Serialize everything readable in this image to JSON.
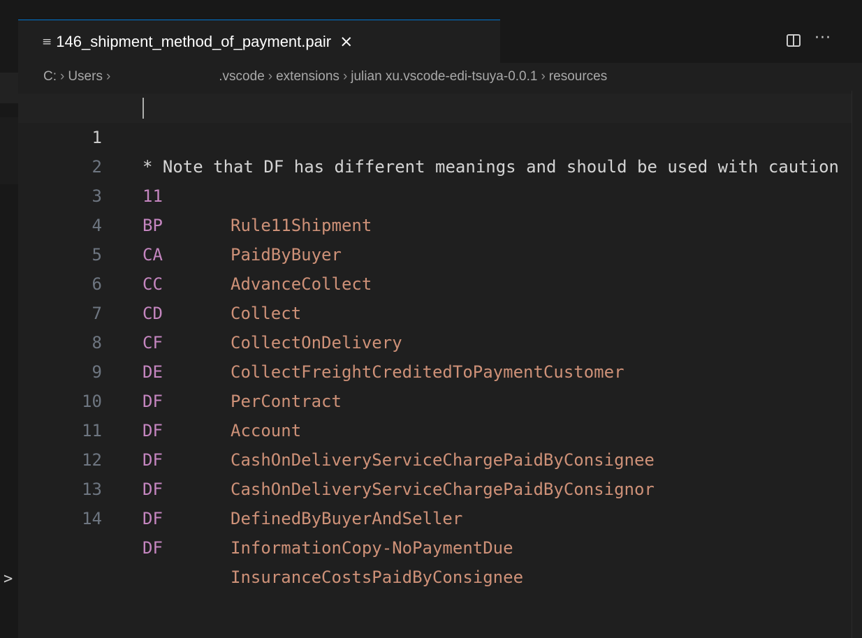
{
  "tab": {
    "label": "146_shipment_method_of_payment.pair",
    "file_icon": "≡",
    "close_icon": "×"
  },
  "toolbar": {
    "more_icon": "···"
  },
  "breadcrumb": [
    "C:",
    "Users",
    ".vscode",
    "extensions",
    "julian xu.vscode-edi-tsuya-0.0.1",
    "resources"
  ],
  "editor": {
    "lines": [
      {
        "num": "1",
        "comment": "* Note that DF has different meanings and should be used with caution"
      },
      {
        "num": "2",
        "key": "11",
        "value": "Rule11Shipment"
      },
      {
        "num": "3",
        "key": "BP",
        "value": "PaidByBuyer"
      },
      {
        "num": "4",
        "key": "CA",
        "value": "AdvanceCollect"
      },
      {
        "num": "5",
        "key": "CC",
        "value": "Collect"
      },
      {
        "num": "6",
        "key": "CD",
        "value": "CollectOnDelivery"
      },
      {
        "num": "7",
        "key": "CF",
        "value": "CollectFreightCreditedToPaymentCustomer"
      },
      {
        "num": "8",
        "key": "DE",
        "value": "PerContract"
      },
      {
        "num": "9",
        "key": "DF",
        "value": "Account"
      },
      {
        "num": "10",
        "key": "DF",
        "value": "CashOnDeliveryServiceChargePaidByConsignee"
      },
      {
        "num": "11",
        "key": "DF",
        "value": "CashOnDeliveryServiceChargePaidByConsignor"
      },
      {
        "num": "12",
        "key": "DF",
        "value": "DefinedByBuyerAndSeller"
      },
      {
        "num": "13",
        "key": "DF",
        "value": "InformationCopy-NoPaymentDue"
      },
      {
        "num": "14",
        "key": "DF",
        "value": "InsuranceCostsPaidByConsignee"
      }
    ]
  },
  "side_panel": {
    "chevron": ">"
  },
  "colors": {
    "editor_bg": "#1f1f1f",
    "tab_accent": "#0078d4",
    "key": "#c586c0",
    "value": "#ce9178",
    "line_number": "#6e7681"
  }
}
